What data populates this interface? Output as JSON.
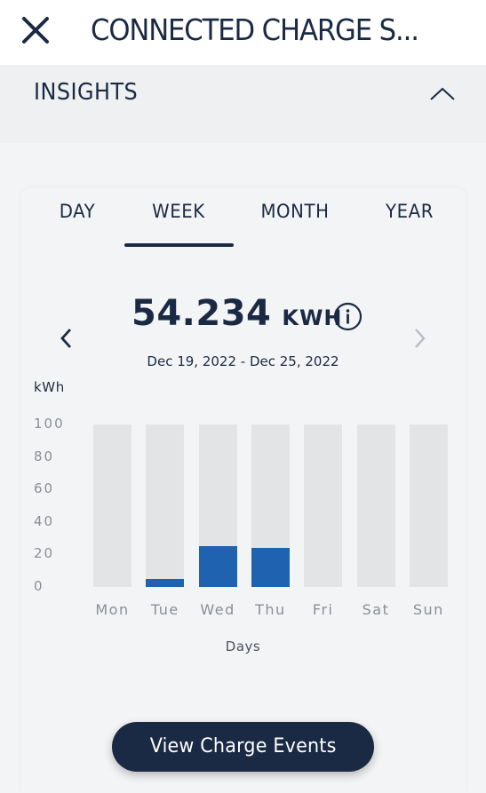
{
  "header": {
    "title": "CONNECTED CHARGE S...",
    "close_icon": "close-icon"
  },
  "insights": {
    "label": "INSIGHTS",
    "collapse_icon": "chevron-up-icon"
  },
  "tabs": [
    {
      "label": "DAY",
      "selected": false
    },
    {
      "label": "WEEK",
      "selected": true
    },
    {
      "label": "MONTH",
      "selected": false
    },
    {
      "label": "YEAR",
      "selected": false
    }
  ],
  "summary": {
    "total_value": "54.234",
    "total_unit": "KWH",
    "date_range": "Dec 19, 2022 - Dec 25, 2022",
    "info_icon": "info-icon",
    "prev_icon": "chevron-left-icon",
    "next_icon": "chevron-right-icon"
  },
  "chart_data": {
    "type": "bar",
    "ylabel": "kWh",
    "xlabel": "Days",
    "ylim": [
      0,
      100
    ],
    "yticks": [
      "100",
      "80",
      "60",
      "40",
      "20",
      "0"
    ],
    "categories": [
      "Mon",
      "Tue",
      "Wed",
      "Thu",
      "Fri",
      "Sat",
      "Sun"
    ],
    "values": [
      0,
      5,
      25,
      24,
      0,
      0,
      0
    ],
    "grid": false
  },
  "footer": {
    "button_label": "View Charge Events"
  },
  "colors": {
    "primary": "#1b2a44",
    "bar_fill": "#1f62b0",
    "bar_track": "#e3e4e5",
    "background": "#f3f4f5"
  }
}
